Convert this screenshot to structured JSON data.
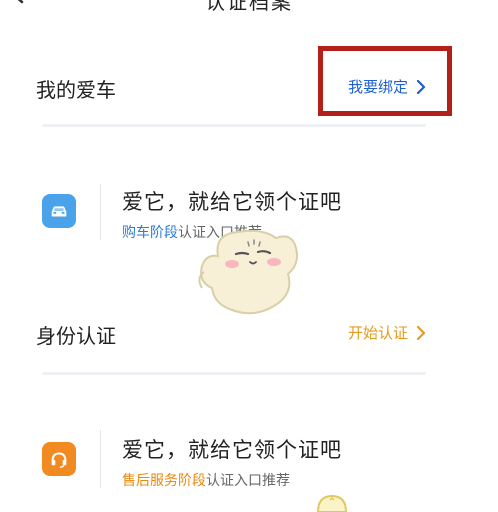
{
  "header": {
    "title": "认证档案"
  },
  "car_section": {
    "title": "我的爱车",
    "action_label": "我要绑定",
    "action_color": "#1f5fd0",
    "card": {
      "title": "爱它，就给它领个证吧",
      "stage_highlight": "购车阶段",
      "stage_rest": "认证入口推荐",
      "highlight_color": "#2c7bd6",
      "icon": "car-icon",
      "icon_color": "#4aa3ea"
    }
  },
  "identity_section": {
    "title": "身份认证",
    "action_label": "开始认证",
    "action_color": "#e39b22",
    "card": {
      "title": "爱它，就给它领个证吧",
      "stage_highlight": "售后服务阶段",
      "stage_rest": "认证入口推荐",
      "highlight_color": "#e8890f",
      "icon": "headset-icon",
      "icon_color": "#f28a22"
    }
  },
  "colors": {
    "annotation_box": "#b3201a",
    "divider": "#eef0f3"
  }
}
